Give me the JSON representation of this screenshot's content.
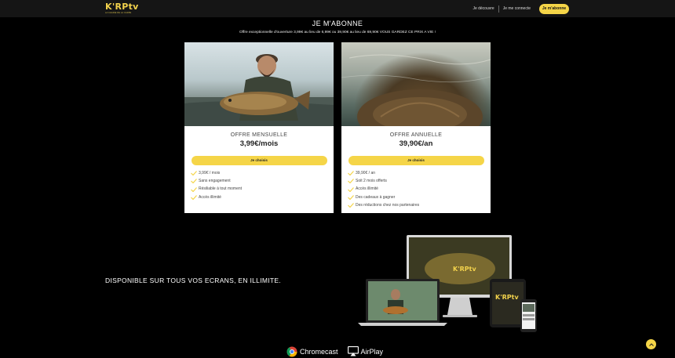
{
  "header": {
    "logo_text": "K'RPtv",
    "logo_sub": "LA CHAINE DE LA CARPE",
    "nav": {
      "discover": "Je découvre",
      "login": "Je me connecte",
      "subscribe": "Je m'abonne"
    }
  },
  "hero": {
    "title": "JE M'ABONNE",
    "subtitle": "Offre exceptionnelle d'ouverture 3,99€ au lieu de 6,99€ ou 39,90€ au lieu de 69,90€ VOUS GARDEZ CE PRIX A VIE !"
  },
  "offers": [
    {
      "name": "OFFRE MENSUELLE",
      "price": "3,99€/mois",
      "button": "Je choisis",
      "features": [
        "3,99€ / mois",
        "Sans engagement",
        "Résiliable à tout moment",
        "Accès illimité"
      ]
    },
    {
      "name": "OFFRE ANNUELLE",
      "price": "39,90€/an",
      "button": "Je choisis",
      "features": [
        "39,90€ / an",
        "Soit 2 mois offerts",
        "Accès illimité",
        "Des cadeaux à gagner",
        "Des réductions chez nos partenaires"
      ]
    }
  ],
  "devices": {
    "headline": "DISPONIBLE SUR TOUS VOS ECRANS, EN ILLIMITE.",
    "screen_logo": "K'RPtv"
  },
  "casting": {
    "chromecast": "Chromecast",
    "airplay": "AirPlay"
  },
  "colors": {
    "accent": "#f5d548",
    "background": "#000000",
    "header": "#151515",
    "check": "#f5d548"
  },
  "icons": [
    "check-icon",
    "chromecast-icon",
    "airplay-icon",
    "chevron-up-icon"
  ]
}
